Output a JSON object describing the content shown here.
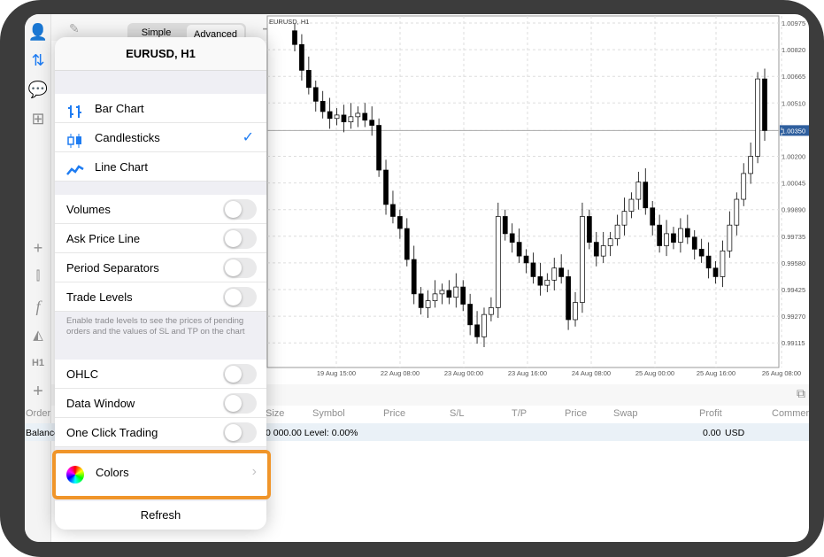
{
  "toolbar": {
    "simple": "Simple",
    "advanced": "Advanced"
  },
  "popup": {
    "title": "EURUSD, H1",
    "chart_types": [
      {
        "label": "Bar Chart",
        "icon": "bar-chart-icon"
      },
      {
        "label": "Candlesticks",
        "icon": "candlesticks-icon",
        "selected": true
      },
      {
        "label": "Line Chart",
        "icon": "line-chart-icon"
      }
    ],
    "toggles1": [
      {
        "label": "Volumes",
        "on": false
      },
      {
        "label": "Ask Price Line",
        "on": false
      },
      {
        "label": "Period Separators",
        "on": false
      },
      {
        "label": "Trade Levels",
        "on": false
      }
    ],
    "note": "Enable trade levels to see the prices of pending orders and the values of SL and TP on the chart",
    "toggles2": [
      {
        "label": "OHLC",
        "on": false
      },
      {
        "label": "Data Window",
        "on": false
      },
      {
        "label": "One Click Trading",
        "on": false
      }
    ],
    "colors": "Colors",
    "refresh": "Refresh",
    "highlight_color": "#f0952a"
  },
  "sidebar": {
    "timeframe": "H1"
  },
  "table": {
    "headers": [
      "Order",
      "Size",
      "Symbol",
      "Price",
      "S/L",
      "T/P",
      "Price",
      "Swap",
      "Profit",
      "Comment"
    ],
    "balance_label": "Balance",
    "balance_text": "0 000.00 Level: 0.00%",
    "profit": "0.00",
    "currency": "USD"
  },
  "chart_data": {
    "type": "candlestick",
    "title": "EURUSD, H1",
    "y_ticks": [
      "1.00975",
      "1.00820",
      "1.00665",
      "1.00510",
      "1.00350",
      "1.00200",
      "1.00045",
      "0.99890",
      "0.99735",
      "0.99580",
      "0.99425",
      "0.99270",
      "0.99115"
    ],
    "x_ticks": [
      "19 Aug 15:00",
      "22 Aug 08:00",
      "23 Aug 00:00",
      "23 Aug 16:00",
      "24 Aug 08:00",
      "25 Aug 00:00",
      "25 Aug 16:00",
      "26 Aug 08:00"
    ],
    "current_price": "1.00350",
    "ylim": [
      0.9905,
      1.0101
    ],
    "first_open": 1.0093,
    "closes": [
      1.0085,
      1.007,
      1.006,
      1.0052,
      1.0046,
      1.0042,
      1.0044,
      1.004,
      1.0043,
      1.0045,
      1.0041,
      1.0038,
      1.0012,
      0.9992,
      0.9985,
      0.9978,
      0.996,
      0.994,
      0.9932,
      0.9936,
      0.994,
      0.9942,
      0.9938,
      0.9944,
      0.9934,
      0.9922,
      0.9915,
      0.9928,
      0.9932,
      0.9985,
      0.9975,
      0.997,
      0.9962,
      0.9958,
      0.995,
      0.9945,
      0.9948,
      0.9955,
      0.995,
      0.9925,
      0.9935,
      0.9985,
      0.997,
      0.9962,
      0.9968,
      0.9972,
      0.998,
      0.9988,
      0.9995,
      1.0005,
      0.999,
      0.998,
      0.9968,
      0.9975,
      0.997,
      0.9978,
      0.9973,
      0.9966,
      0.9962,
      0.9955,
      0.995,
      0.9965,
      0.998,
      0.9995,
      1.001,
      1.002,
      1.0065,
      1.0035
    ],
    "grid": true
  }
}
